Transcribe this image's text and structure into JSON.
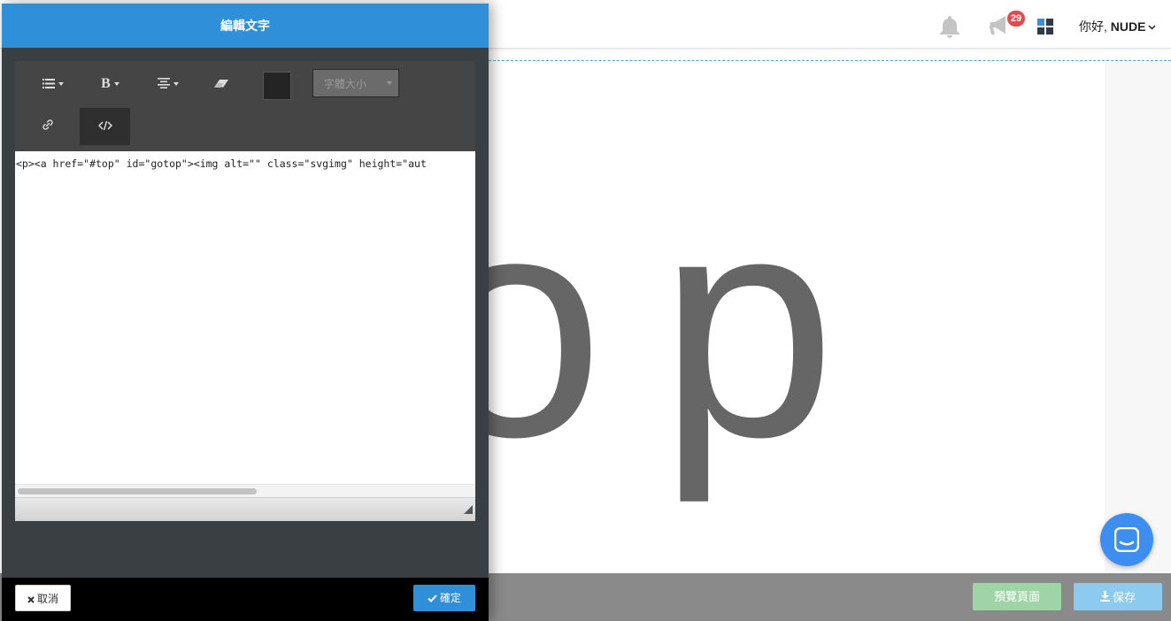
{
  "header": {
    "notification_count": "29",
    "greeting_prefix": "你好, ",
    "user_name": "NUDE"
  },
  "canvas": {
    "preview_text": "op"
  },
  "footer": {
    "preview_label": "預覽頁面",
    "save_label": "保存"
  },
  "editor_panel": {
    "title": "編輯文字",
    "toolbar": {
      "list_icon": "list-icon",
      "bold_label": "B",
      "align_icon": "align-center-icon",
      "eraser_icon": "eraser-icon",
      "text_color": "#242424",
      "font_size_placeholder": "字體大小",
      "link_icon": "link-icon",
      "code_icon": "code-icon"
    },
    "code_content": "<p><a href=\"#top\" id=\"gotop\"><img alt=\"\" class=\"svgimg\" height=\"aut",
    "cancel_label": "取消",
    "confirm_label": "確定"
  },
  "colors": {
    "panel_header": "#2f8fd8",
    "panel_body": "#3a3f44",
    "preview_button": "#9fd4a6",
    "save_button": "#8ccaf0",
    "badge": "#e5484d",
    "chat_bubble": "#3d8ef0"
  }
}
